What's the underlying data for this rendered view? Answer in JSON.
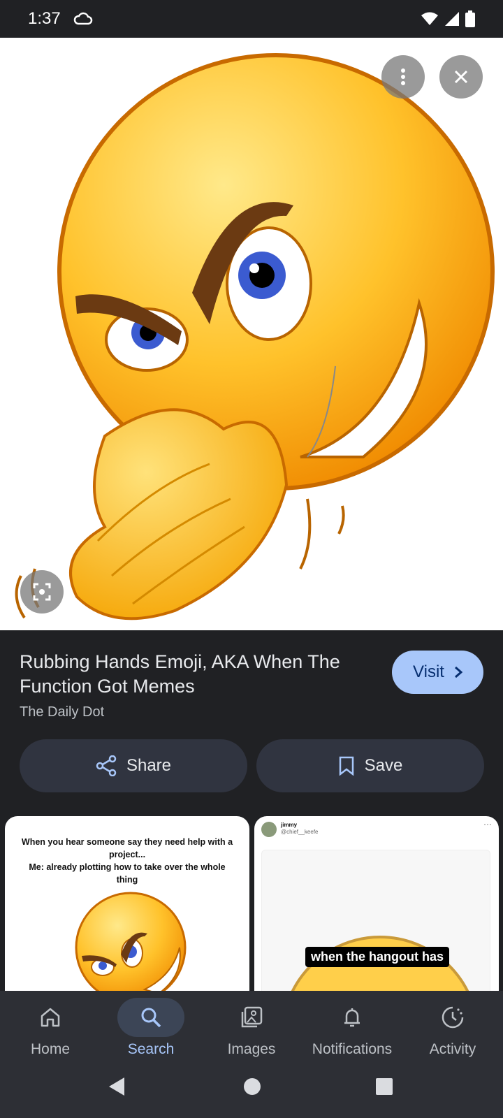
{
  "status_bar": {
    "time": "1:37",
    "icons": [
      "cloud-icon",
      "wifi-icon",
      "signal-icon",
      "battery-icon"
    ]
  },
  "viewer": {
    "image_alt": "Rubbing hands smiling emoji",
    "actions": {
      "more_icon": "more-vert-icon",
      "close_icon": "close-icon",
      "lens_icon": "lens-icon"
    }
  },
  "result": {
    "title": "Rubbing Hands Emoji, AKA When The Function Got Memes",
    "source": "The Daily Dot",
    "visit_label": "Visit",
    "share_label": "Share",
    "save_label": "Save"
  },
  "related": {
    "left": {
      "caption": "When you hear someone say they need help with a project...\nMe:  already plotting how to take over the whole thing"
    },
    "right": {
      "name": "jimmy",
      "handle": "@chief__keefe",
      "label": "when the hangout has"
    }
  },
  "bottom_nav": {
    "items": [
      {
        "label": "Home",
        "icon": "home-icon"
      },
      {
        "label": "Search",
        "icon": "search-icon",
        "active": true
      },
      {
        "label": "Images",
        "icon": "images-icon"
      },
      {
        "label": "Notifications",
        "icon": "bell-icon"
      },
      {
        "label": "Activity",
        "icon": "activity-icon"
      }
    ]
  },
  "colors": {
    "accent": "#a8c7fa",
    "background": "#202124",
    "pill": "#303440"
  }
}
